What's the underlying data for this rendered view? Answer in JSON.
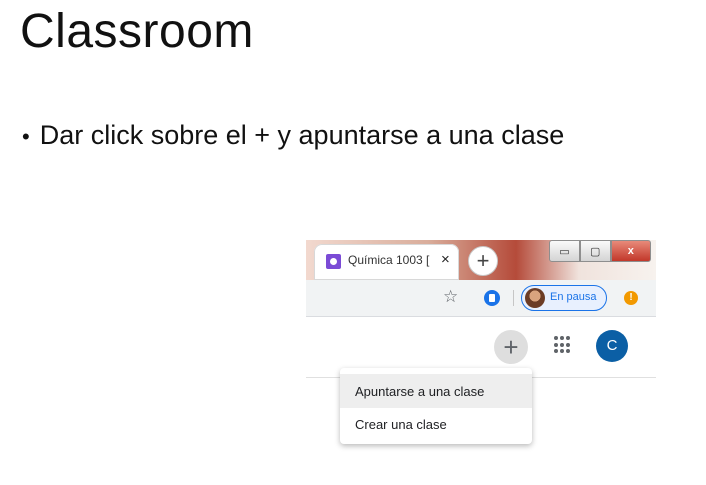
{
  "slide": {
    "title": "Classroom",
    "bullet": "Dar click sobre el + y apuntarse a una clase"
  },
  "browser": {
    "tab_title": "Química 1003 [",
    "tab_close": "×",
    "new_tab": "+",
    "window_min": "▭",
    "window_max": "▢",
    "window_close": "x",
    "bookmark_star": "☆",
    "profile_label": "En pausa",
    "alert_mark": "!"
  },
  "classroom": {
    "add_button": "+",
    "account_initial": "C",
    "menu": {
      "items": [
        {
          "label": "Apuntarse a una clase",
          "highlighted": true
        },
        {
          "label": "Crear una clase",
          "highlighted": false
        }
      ]
    }
  },
  "colors": {
    "profile_accent": "#1a73e8",
    "avatar_bg": "#0b5fa5",
    "alert": "#f29900",
    "tab_favicon": "#7b4bd6"
  }
}
